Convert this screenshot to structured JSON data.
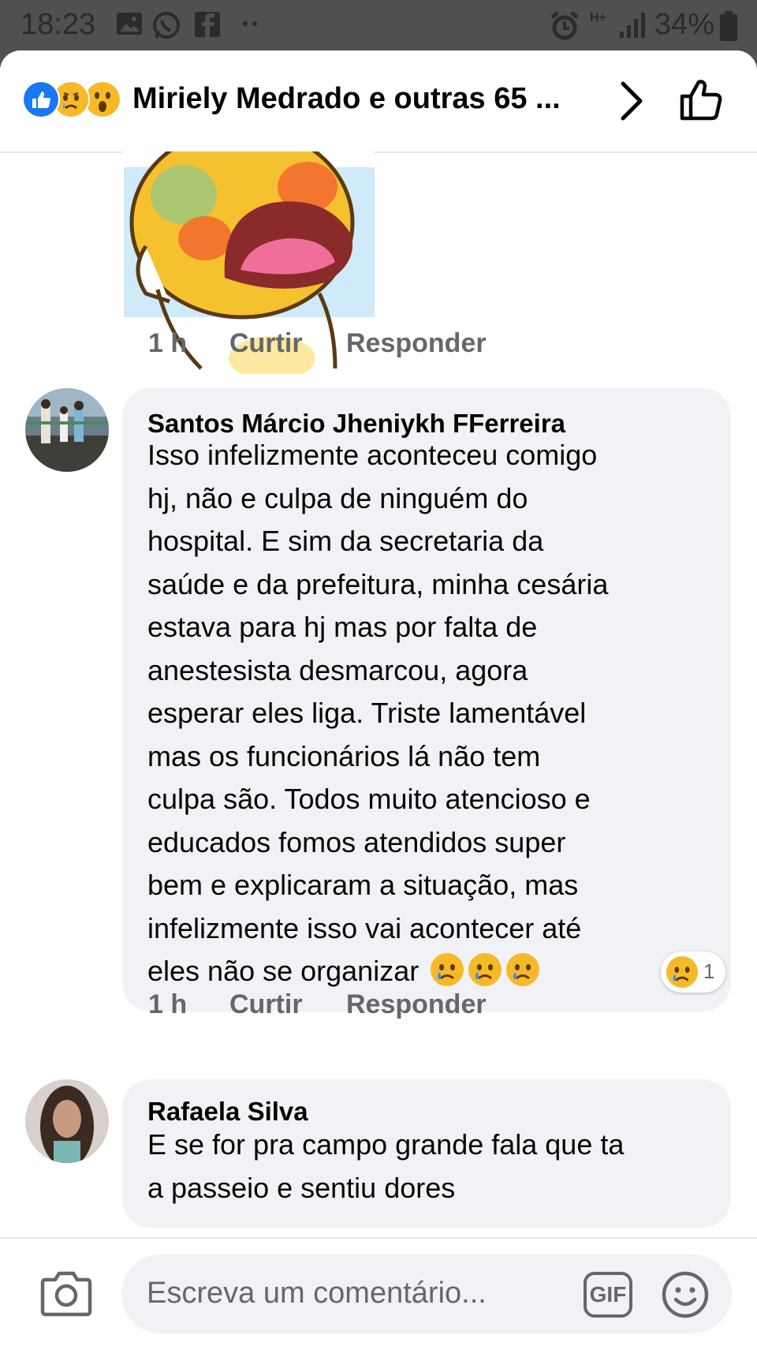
{
  "status_bar": {
    "time": "18:23",
    "battery": "34%",
    "network": "H+"
  },
  "header": {
    "title": "Miriely Medrado e outras 65 ...",
    "reaction_icons": [
      "like-icon",
      "sad-icon",
      "wow-icon"
    ]
  },
  "comments": [
    {
      "type": "sticker",
      "sticker": "crying-yellow-bear-sticker",
      "time": "1 h",
      "like_label": "Curtir",
      "reply_label": "Responder"
    },
    {
      "author": "Santos Márcio Jheniykh FFerreira",
      "lines": [
        "Isso infelizmente aconteceu comigo",
        "hj, não e culpa de ninguém do",
        "hospital. E sim da secretaria da",
        "saúde e da prefeitura, minha cesária",
        "estava para hj mas por falta de",
        "anestesista desmarcou, agora",
        "esperar eles liga. Triste lamentável",
        "mas os funcionários lá não tem",
        "culpa são. Todos muito atencioso e",
        "educados fomos atendidos super",
        "bem e explicaram a situação, mas",
        "infelizmente isso vai acontecer até",
        "eles não se organizar"
      ],
      "trailing_emojis": [
        "sad-tear-emoji",
        "sad-tear-emoji",
        "sad-tear-emoji"
      ],
      "time": "1 h",
      "like_label": "Curtir",
      "reply_label": "Responder",
      "reaction_count": "1"
    },
    {
      "author": "Rafaela Silva",
      "lines": [
        "E se for pra campo grande fala que ta",
        "a passeio e sentiu dores"
      ]
    }
  ],
  "composer": {
    "placeholder": "Escreva um comentário...",
    "gif_label": "GIF"
  },
  "colors": {
    "like_blue": "#1877f2",
    "bubble_bg": "#f0f2f5",
    "meta_gray": "#65676b",
    "emoji_yellow": "#f7b928"
  }
}
